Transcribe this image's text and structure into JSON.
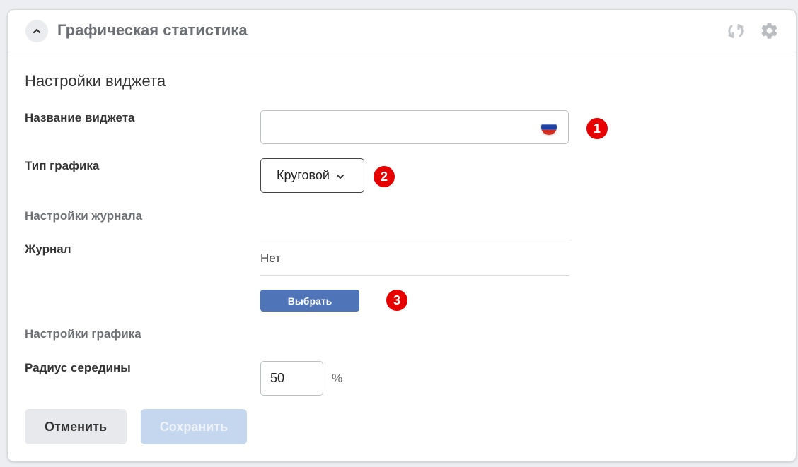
{
  "header": {
    "title": "Графическая статистика",
    "collapse_icon": "chevron-up-icon",
    "refresh_icon": "refresh-icon",
    "settings_icon": "gear-icon"
  },
  "form": {
    "section_title": "Настройки виджета",
    "widget_name": {
      "label": "Название виджета",
      "value": "",
      "placeholder": "",
      "language_icon": "russian-flag-icon"
    },
    "chart_type": {
      "label": "Тип графика",
      "selected": "Круговой"
    },
    "journal_settings_heading": "Настройки журнала",
    "journal": {
      "label": "Журнал",
      "value": "Нет",
      "choose_button": "Выбрать"
    },
    "chart_settings_heading": "Настройки графика",
    "center_radius": {
      "label": "Радиус середины",
      "value": "50",
      "unit": "%"
    }
  },
  "markers": [
    "1",
    "2",
    "3"
  ],
  "actions": {
    "cancel_label": "Отменить",
    "save_label": "Сохранить"
  },
  "colors": {
    "marker": "#e60000",
    "primary_button": "#4f74b8",
    "save_disabled": "#c5d6ef",
    "cancel_bg": "#e7e9ec"
  }
}
